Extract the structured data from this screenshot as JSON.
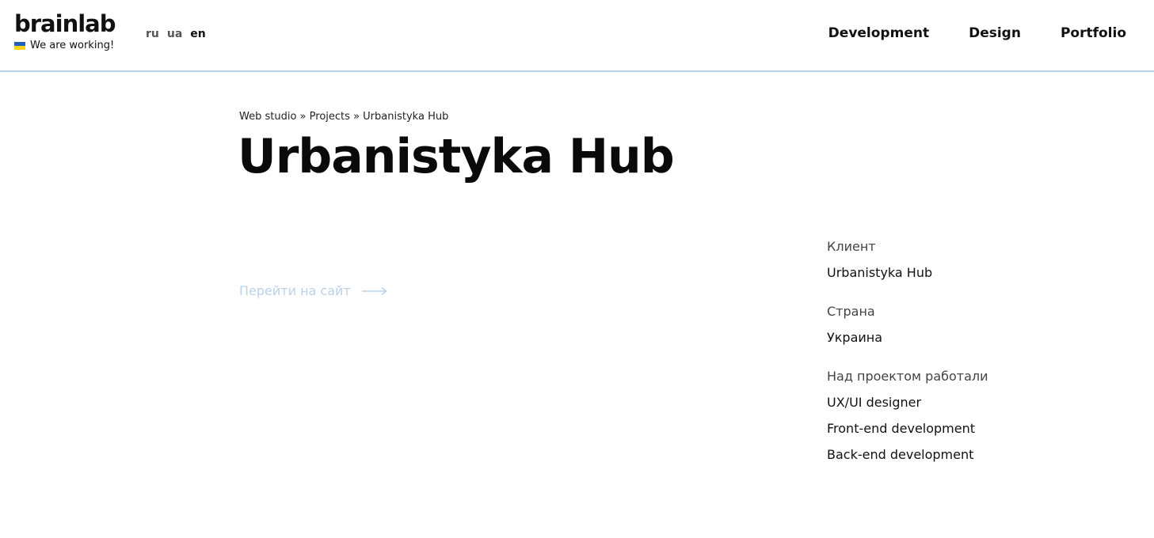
{
  "header": {
    "logo": "brainlab",
    "working_text": "We are working!",
    "langs": [
      "ru",
      "ua",
      "en"
    ],
    "active_lang": "en",
    "nav": [
      "Development",
      "Design",
      "Portfolio"
    ]
  },
  "breadcrumb": {
    "items": [
      "Web studio",
      "Projects",
      "Urbanistyka Hub"
    ],
    "separator": "»"
  },
  "page": {
    "title": "Urbanistyka Hub",
    "visit_label": "Перейти на сайт"
  },
  "info": {
    "client_label": "Клиент",
    "client_value": "Urbanistyka Hub",
    "country_label": "Страна",
    "country_value": "Украина",
    "team_label": "Над проектом работали",
    "team": [
      "UX/UI designer",
      "Front-end development",
      "Back-end development"
    ]
  },
  "colors": {
    "accent_light": "#b9d2ec",
    "flag_blue": "#1f5fc2",
    "flag_yellow": "#ffd21c"
  }
}
